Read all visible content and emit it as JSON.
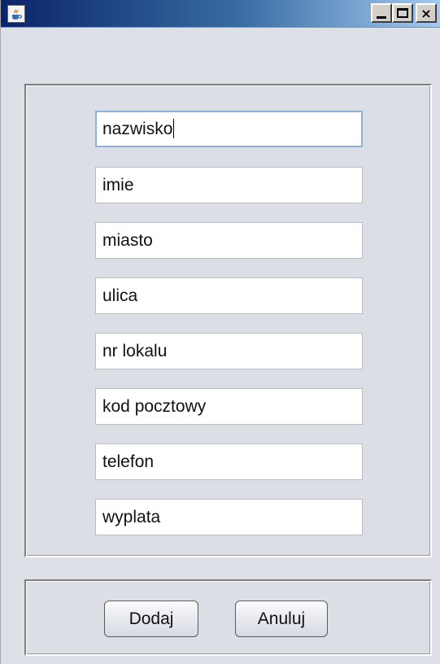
{
  "window": {
    "icon": "java-cup-icon",
    "controls": {
      "minimize": "minimize-icon",
      "maximize": "maximize-icon",
      "close": "close-icon",
      "close_glyph": "×"
    }
  },
  "form": {
    "fields": [
      {
        "value": "nazwisko"
      },
      {
        "value": "imie"
      },
      {
        "value": "miasto"
      },
      {
        "value": "ulica"
      },
      {
        "value": "nr lokalu"
      },
      {
        "value": "kod pocztowy"
      },
      {
        "value": "telefon"
      },
      {
        "value": "wyplata"
      }
    ]
  },
  "actions": {
    "add_label": "Dodaj",
    "cancel_label": "Anuluj"
  },
  "colors": {
    "titlebar_start": "#0a246a",
    "titlebar_end": "#a6caf0",
    "window_bg": "#dee0e8",
    "focus_border": "#8fb0d8"
  }
}
